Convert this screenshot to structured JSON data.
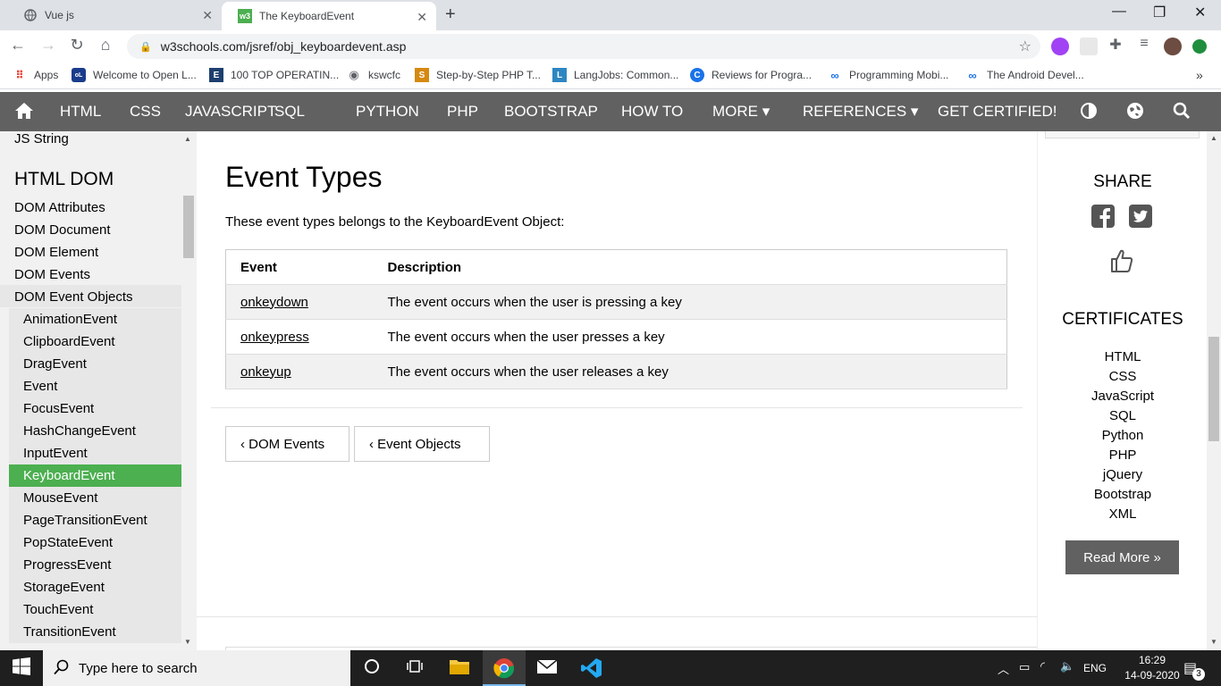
{
  "browser": {
    "tabs": [
      {
        "title": "Vue js",
        "active": false
      },
      {
        "title": "The KeyboardEvent",
        "active": true
      }
    ],
    "url": "w3schools.com/jsref/obj_keyboardevent.asp",
    "bookmarks": [
      "Apps",
      "Welcome to Open L...",
      "100 TOP OPERATIN...",
      "kswcfc",
      "Step-by-Step PHP T...",
      "LangJobs: Common...",
      "Reviews for Progra...",
      "Programming Mobi...",
      "The Android Devel..."
    ],
    "new_tab": "+",
    "more_bookmarks": "»"
  },
  "w3nav": {
    "items": [
      "HTML",
      "CSS",
      "JAVASCRIPT",
      "SQL",
      "PYTHON",
      "PHP",
      "BOOTSTRAP",
      "HOW TO",
      "MORE ▾",
      "REFERENCES ▾",
      "GET CERTIFIED!"
    ]
  },
  "sidebar": {
    "top_item": "JS String",
    "heading": "HTML DOM",
    "items": [
      "DOM Attributes",
      "DOM Document",
      "DOM Element",
      "DOM Events",
      "DOM Event Objects"
    ],
    "sub_items": [
      "AnimationEvent",
      "ClipboardEvent",
      "DragEvent",
      "Event",
      "FocusEvent",
      "HashChangeEvent",
      "InputEvent",
      "KeyboardEvent",
      "MouseEvent",
      "PageTransitionEvent",
      "PopStateEvent",
      "ProgressEvent",
      "StorageEvent",
      "TouchEvent",
      "TransitionEvent"
    ],
    "active_sub": "KeyboardEvent"
  },
  "main": {
    "title": "Event Types",
    "intro": "These event types belongs to the KeyboardEvent Object:",
    "table": {
      "headers": [
        "Event",
        "Description"
      ],
      "rows": [
        {
          "event": "onkeydown",
          "description": "The event occurs when the user is pressing a key"
        },
        {
          "event": "onkeypress",
          "description": "The event occurs when the user presses a key"
        },
        {
          "event": "onkeyup",
          "description": "The event occurs when the user releases a key"
        }
      ]
    },
    "prev_button": "‹ DOM Events",
    "next_button": "‹ Event Objects"
  },
  "right": {
    "share_heading": "SHARE",
    "certificates_heading": "CERTIFICATES",
    "certificates": [
      "HTML",
      "CSS",
      "JavaScript",
      "SQL",
      "Python",
      "PHP",
      "jQuery",
      "Bootstrap",
      "XML"
    ],
    "read_more": "Read More »"
  },
  "taskbar": {
    "search_placeholder": "Type here to search",
    "language": "ENG",
    "time": "16:29",
    "date": "14-09-2020",
    "notifications": "3"
  },
  "colors": {
    "nav_bg": "#616161",
    "active_green": "#4caf50"
  }
}
